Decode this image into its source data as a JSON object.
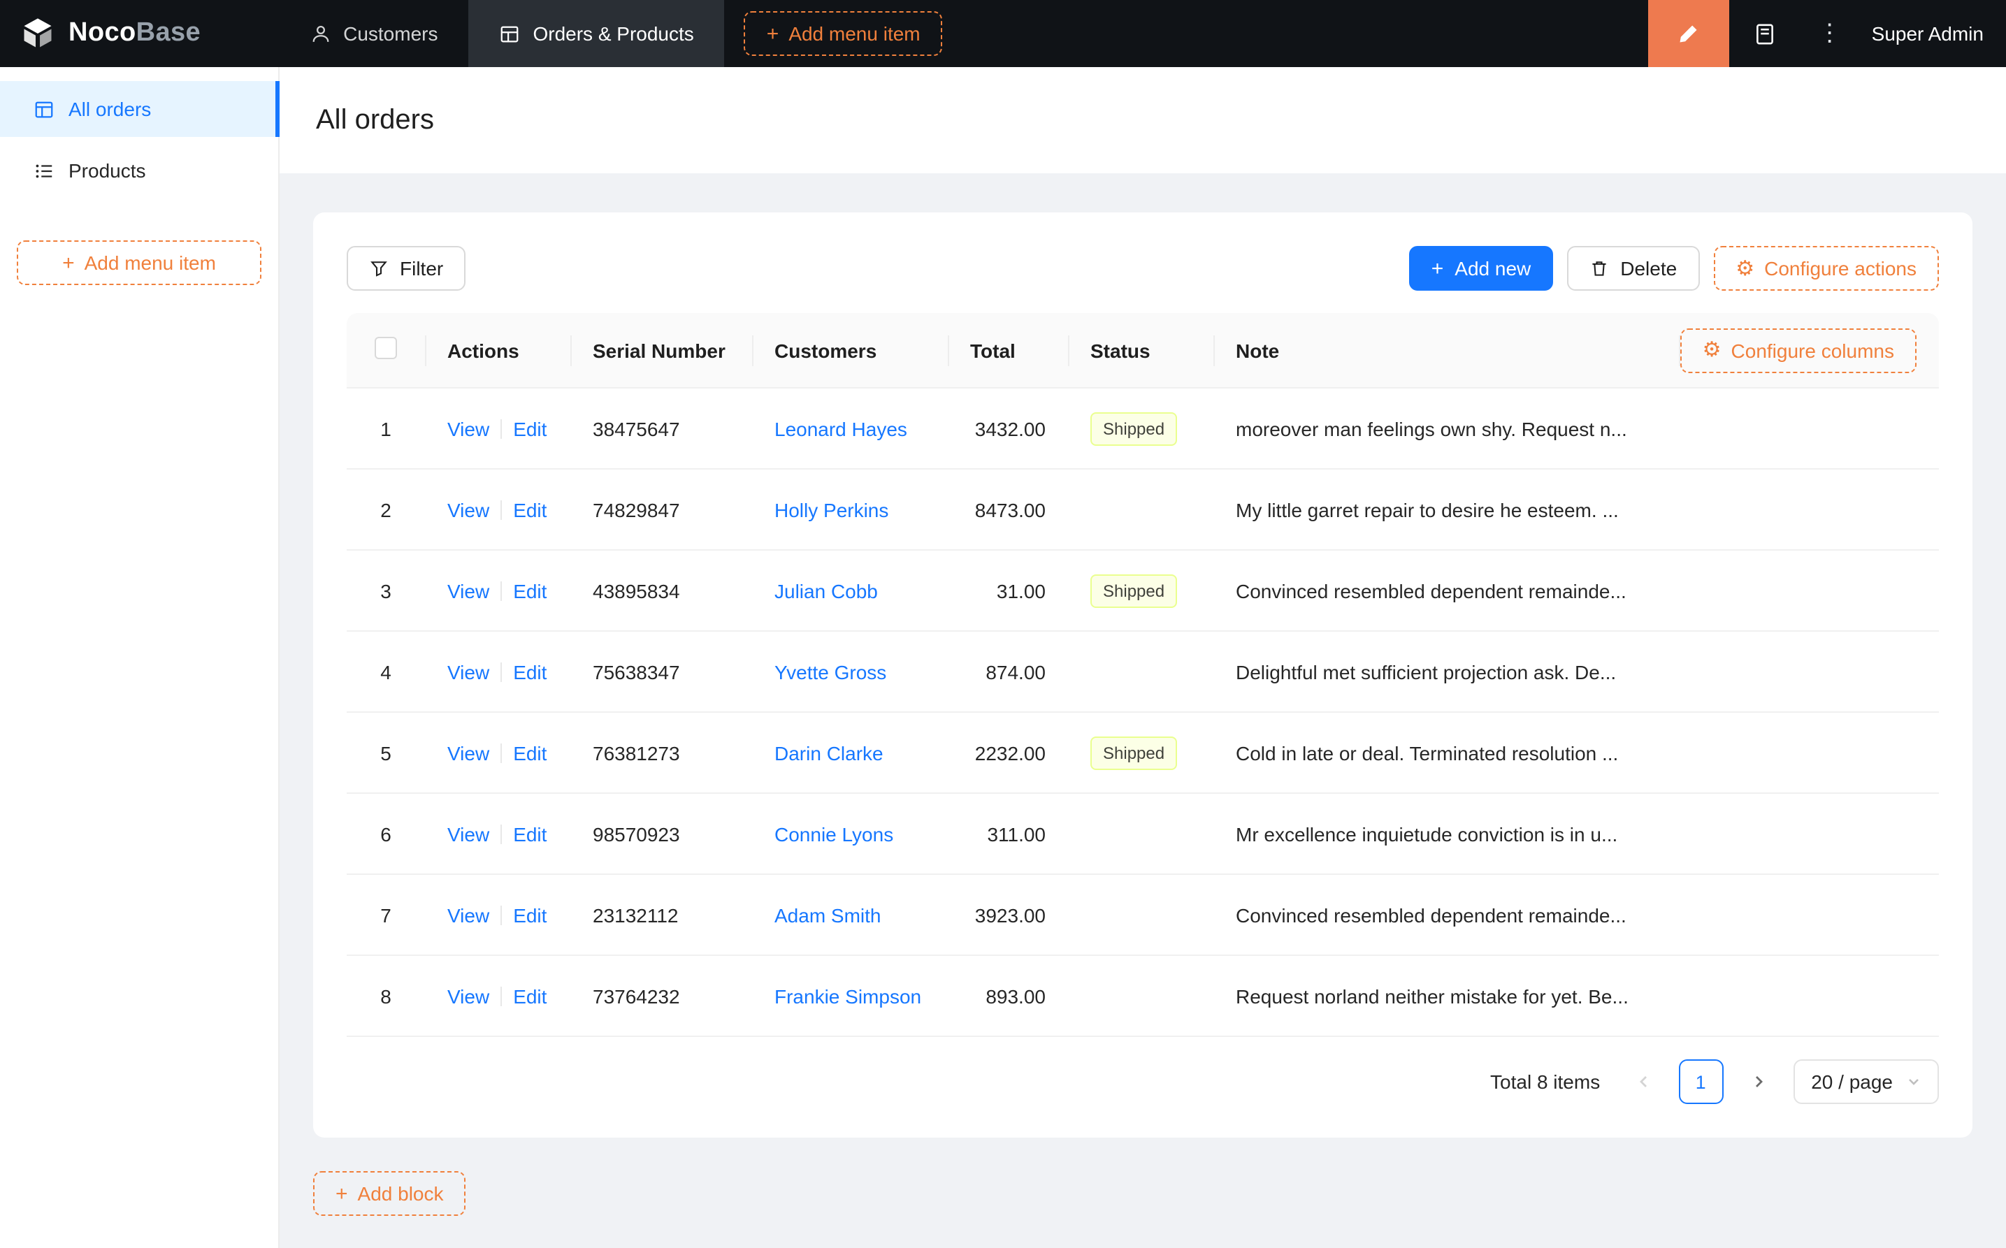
{
  "topbar": {
    "logo_primary": "Noco",
    "logo_secondary": "Base",
    "menu_items": [
      {
        "label": "Customers"
      },
      {
        "label": "Orders & Products"
      }
    ],
    "add_menu_item_label": "Add menu item",
    "user_name": "Super Admin"
  },
  "sidebar": {
    "items": [
      {
        "label": "All orders"
      },
      {
        "label": "Products"
      }
    ],
    "add_menu_item_label": "Add menu item"
  },
  "page": {
    "title": "All orders",
    "add_block_label": "Add block"
  },
  "toolbar": {
    "filter_label": "Filter",
    "add_new_label": "Add new",
    "delete_label": "Delete",
    "configure_actions_label": "Configure actions"
  },
  "table": {
    "configure_columns_label": "Configure columns",
    "headers": {
      "actions": "Actions",
      "serial": "Serial Number",
      "customers": "Customers",
      "total": "Total",
      "status": "Status",
      "note": "Note"
    },
    "view_label": "View",
    "edit_label": "Edit",
    "rows": [
      {
        "index": "1",
        "serial": "38475647",
        "customer": "Leonard Hayes",
        "total": "3432.00",
        "status": "Shipped",
        "note": "moreover man feelings own shy. Request n..."
      },
      {
        "index": "2",
        "serial": "74829847",
        "customer": "Holly Perkins",
        "total": "8473.00",
        "status": "",
        "note": "My little garret repair to desire he esteem. ..."
      },
      {
        "index": "3",
        "serial": "43895834",
        "customer": "Julian Cobb",
        "total": "31.00",
        "status": "Shipped",
        "note": "Convinced resembled dependent remainde..."
      },
      {
        "index": "4",
        "serial": "75638347",
        "customer": "Yvette Gross",
        "total": "874.00",
        "status": "",
        "note": "Delightful met sufficient projection ask. De..."
      },
      {
        "index": "5",
        "serial": "76381273",
        "customer": "Darin Clarke",
        "total": "2232.00",
        "status": "Shipped",
        "note": "Cold in late or deal. Terminated resolution ..."
      },
      {
        "index": "6",
        "serial": "98570923",
        "customer": "Connie Lyons",
        "total": "311.00",
        "status": "",
        "note": "Mr excellence inquietude conviction is in u..."
      },
      {
        "index": "7",
        "serial": "23132112",
        "customer": "Adam Smith",
        "total": "3923.00",
        "status": "",
        "note": "Convinced resembled dependent remainde..."
      },
      {
        "index": "8",
        "serial": "73764232",
        "customer": "Frankie Simpson",
        "total": "893.00",
        "status": "",
        "note": "Request norland neither mistake for yet. Be..."
      }
    ]
  },
  "pagination": {
    "total_text": "Total 8 items",
    "current_page": "1",
    "page_size": "20 / page"
  },
  "colors": {
    "topbar_bg": "#101317",
    "accent_orange": "#f0803c",
    "designer_button_bg": "#ee7a4f",
    "link_blue": "#1677ff",
    "active_item_bg": "#e6f4ff",
    "tag_bg": "#fcffe6",
    "tag_border": "#eaff8f",
    "page_bg": "#f0f2f5"
  }
}
